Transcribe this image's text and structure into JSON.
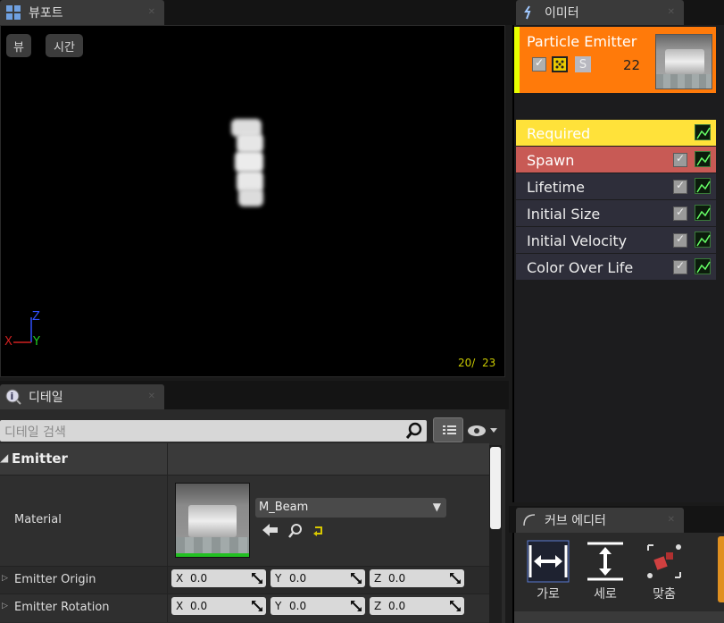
{
  "viewport": {
    "tab_title": "뷰포트",
    "btn_view": "뷰",
    "btn_time": "시간",
    "axis_z": "Z",
    "axis_x": "X",
    "axis_y": "Y",
    "frame_counter": "20/  23",
    "colors": {
      "x": "#d02020",
      "y": "#20d020",
      "z": "#3050ff",
      "counter": "#c8c800"
    }
  },
  "emitters": {
    "tab_title": "이미터",
    "emitter": {
      "name": "Particle Emitter",
      "count": "22",
      "solo_label": "S",
      "bg_color": "#ff7a0a",
      "indicator_color": "#e8ff00"
    },
    "modules": [
      {
        "label": "Required",
        "bg": "#ffe23a",
        "checkbox": false
      },
      {
        "label": "Spawn",
        "bg": "#c85a55",
        "checkbox": true
      },
      {
        "label": "Lifetime",
        "bg": "#2e2e3a",
        "checkbox": true
      },
      {
        "label": "Initial Size",
        "bg": "#2e2e3a",
        "checkbox": true
      },
      {
        "label": "Initial Velocity",
        "bg": "#2e2e3a",
        "checkbox": true
      },
      {
        "label": "Color Over Life",
        "bg": "#2e2e3a",
        "checkbox": true
      }
    ]
  },
  "details": {
    "tab_title": "디테일",
    "search_placeholder": "디테일 검색",
    "section": "Emitter",
    "material_label": "Material",
    "material_value": "M_Beam",
    "rows": [
      {
        "label": "Emitter Origin",
        "x": "0.0",
        "y": "0.0",
        "z": "0.0"
      },
      {
        "label": "Emitter Rotation",
        "x": "0.0",
        "y": "0.0",
        "z": "0.0"
      }
    ],
    "axis_labels": {
      "x": "X",
      "y": "Y",
      "z": "Z"
    }
  },
  "curve_editor": {
    "tab_title": "커브 에디터",
    "btn_horizontal": "가로",
    "btn_vertical": "세로",
    "btn_fit": "맞춤"
  }
}
